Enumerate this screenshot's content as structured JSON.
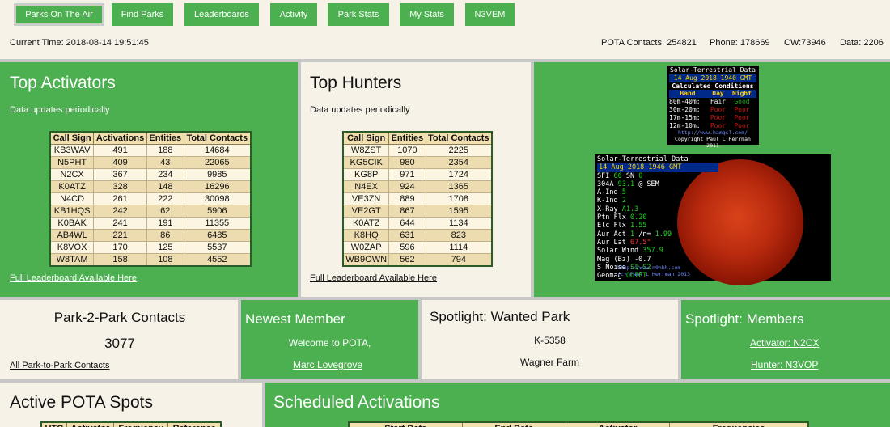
{
  "nav": [
    {
      "label": "Parks On The Air",
      "active": true
    },
    {
      "label": "Find Parks"
    },
    {
      "label": "Leaderboards"
    },
    {
      "label": "Activity"
    },
    {
      "label": "Park Stats"
    },
    {
      "label": "My Stats"
    },
    {
      "label": "N3VEM"
    }
  ],
  "status": {
    "current_time": "Current Time: 2018-08-14 19:51:45",
    "pota_contacts": "POTA Contacts: 254821",
    "phone": "Phone: 178669",
    "cw": "CW:73946",
    "data": "Data: 2206"
  },
  "top_activators": {
    "title": "Top Activators",
    "note": "Data updates periodically",
    "headers": [
      "Call Sign",
      "Activations",
      "Entities",
      "Total Contacts"
    ],
    "rows": [
      [
        "KB3WAV",
        "491",
        "188",
        "14684"
      ],
      [
        "N5PHT",
        "409",
        "43",
        "22065"
      ],
      [
        "N2CX",
        "367",
        "234",
        "9985"
      ],
      [
        "K0ATZ",
        "328",
        "148",
        "16296"
      ],
      [
        "N4CD",
        "261",
        "222",
        "30098"
      ],
      [
        "KB1HQS",
        "242",
        "62",
        "5906"
      ],
      [
        "K0BAK",
        "241",
        "191",
        "11355"
      ],
      [
        "AB4WL",
        "221",
        "86",
        "6485"
      ],
      [
        "K8VOX",
        "170",
        "125",
        "5537"
      ],
      [
        "W8TAM",
        "158",
        "108",
        "4552"
      ]
    ],
    "link": "Full Leaderboard Available Here"
  },
  "top_hunters": {
    "title": "Top Hunters",
    "note": "Data updates periodically",
    "headers": [
      "Call Sign",
      "Entities",
      "Total Contacts"
    ],
    "rows": [
      [
        "W8ZST",
        "1070",
        "2225"
      ],
      [
        "KG5CIK",
        "980",
        "2354"
      ],
      [
        "KG8P",
        "971",
        "1724"
      ],
      [
        "N4EX",
        "924",
        "1365"
      ],
      [
        "VE3ZN",
        "889",
        "1708"
      ],
      [
        "VE2GT",
        "867",
        "1595"
      ],
      [
        "K0ATZ",
        "644",
        "1134"
      ],
      [
        "K8HQ",
        "631",
        "823"
      ],
      [
        "W0ZAP",
        "596",
        "1114"
      ],
      [
        "WB9OWN",
        "562",
        "794"
      ]
    ],
    "link": "Full Leaderboard Available Here"
  },
  "solar_small": {
    "title": "Solar-Terrestrial Data",
    "date": "14 Aug 2018 1940 GMT",
    "subtitle": "Calculated Conditions",
    "head_band": "Band",
    "head_day": "Day",
    "head_night": "Night",
    "bands": [
      {
        "band": "80m-40m:",
        "day": "Fair",
        "night": "Good",
        "day_color": "#f4f4f4",
        "night_color": "#1ea51e"
      },
      {
        "band": "30m-20m:",
        "day": "Poor",
        "night": "Poor",
        "day_color": "#e01010",
        "night_color": "#e01010"
      },
      {
        "band": "17m-15m:",
        "day": "Poor",
        "night": "Poor",
        "day_color": "#e01010",
        "night_color": "#e01010"
      },
      {
        "band": "12m-10m:",
        "day": "Poor",
        "night": "Poor",
        "day_color": "#e01010",
        "night_color": "#e01010"
      }
    ],
    "url": "http://www.hamqsl.com/",
    "copyright": "Copyright Paul L Herrman 2011"
  },
  "solar_big": {
    "title": "Solar-Terrestrial Data",
    "date": "14 Aug 2018 1946 GMT",
    "rows": [
      {
        "label": "SFI",
        "value": "66",
        "label2": "SN",
        "value2": "0"
      },
      {
        "label": "304A",
        "value": "93.1",
        "extra": "@ SEM"
      },
      {
        "label": "A-Ind",
        "value": "5"
      },
      {
        "label": "K-Ind",
        "value": "2"
      },
      {
        "label": "X-Ray",
        "value": "A1.3"
      },
      {
        "label": "Ptn Flx",
        "value": "0.20"
      },
      {
        "label": "Elc Flx",
        "value": "1.55"
      },
      {
        "label": "Aur Act",
        "value": "1",
        "extra": "/n=",
        "value2": "1.99"
      },
      {
        "label": "Aur Lat",
        "value": "67.5°",
        "red": true
      },
      {
        "label": "Solar Wind",
        "value": "357.9"
      },
      {
        "label": "Mag (Bz)",
        "value": "-0.7",
        "white": true
      },
      {
        "label": "S Noise",
        "value": "S1-S2"
      },
      {
        "label": "Geomag",
        "value": "QUIET"
      }
    ],
    "url": "http://www.n0nbh.com",
    "copyright": "(c) Paul L Herrman 2013",
    "value_color": "#1fd41f"
  },
  "p2p": {
    "title": "Park-2-Park Contacts",
    "count": "3077",
    "link": "All Park-to-Park Contacts"
  },
  "newest_member": {
    "title": "Newest Member",
    "welcome": "Welcome to POTA,",
    "name": "Marc Lovegrove"
  },
  "wanted_park": {
    "title": "Spotlight: Wanted Park",
    "park_id": "K-5358",
    "park_name": "Wagner Farm"
  },
  "members": {
    "title": "Spotlight: Members",
    "activator": "Activator: N2CX",
    "hunter": "Hunter: N3VOP"
  },
  "spots": {
    "title": "Active POTA Spots",
    "headers": [
      "UTC",
      "Activator",
      "Frequency",
      "Reference"
    ]
  },
  "scheduled": {
    "title": "Scheduled Activations",
    "headers": [
      "Start Date",
      "End Date",
      "Activator",
      "Frequencies"
    ]
  }
}
